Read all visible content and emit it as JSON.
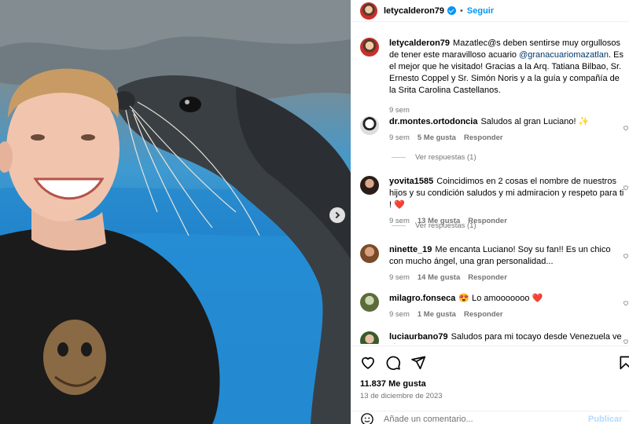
{
  "header": {
    "username": "letycalderon79",
    "separator": "•",
    "follow_label": "Seguir"
  },
  "caption": {
    "username": "letycalderon79",
    "text_before": "Mazatlec@s deben sentirse muy orgullosos de tener este maravilloso acuario ",
    "mention": "@granacuariomazatlan",
    "text_after": ". Es el mejor que he visitado! Gracias a la Arq. Tatiana Bilbao, Sr. Ernesto Coppel y Sr. Simón Noris y a la guía y compañía de la Srita Carolina Castellanos.",
    "time": "9 sem"
  },
  "comments": [
    {
      "username": "dr.montes.ortodoncia",
      "text": "Saludos al gran Luciano! ✨",
      "time": "9 sem",
      "likes": "5 Me gusta",
      "reply": "Responder",
      "view_replies": "Ver respuestas (1)"
    },
    {
      "username": "yovita1585",
      "text": "Coincidimos en 2 cosas el nombre de nuestros hijos y su condición saludos y mi admiracion y respeto para ti ! ❤️",
      "time": "9 sem",
      "likes": "13 Me gusta",
      "reply": "Responder",
      "view_replies": "Ver respuestas (1)"
    },
    {
      "username": "ninette_19",
      "text": "Me encanta Luciano! Soy su fan!! Es un chico con mucho ángel, una gran personalidad...",
      "time": "9 sem",
      "likes": "14 Me gusta",
      "reply": "Responder"
    },
    {
      "username": "milagro.fonseca",
      "text": "😍 Lo amooooooo ❤️",
      "time": "9 sem",
      "likes": "1 Me gusta",
      "reply": "Responder"
    },
    {
      "username": "luciaurbano79",
      "text": "Saludos para mi tocayo desde Venezuela ve🙏"
    }
  ],
  "actions": {
    "icons": [
      "heart-icon",
      "comment-icon",
      "share-icon",
      "bookmark-icon"
    ],
    "likes": "11.837 Me gusta",
    "date": "13 de diciembre de 2023",
    "add_comment_placeholder": "Añade un comentario...",
    "publish_label": "Publicar"
  },
  "colors": {
    "accent": "#0095f6",
    "mention": "#00376b",
    "muted": "#737373"
  }
}
